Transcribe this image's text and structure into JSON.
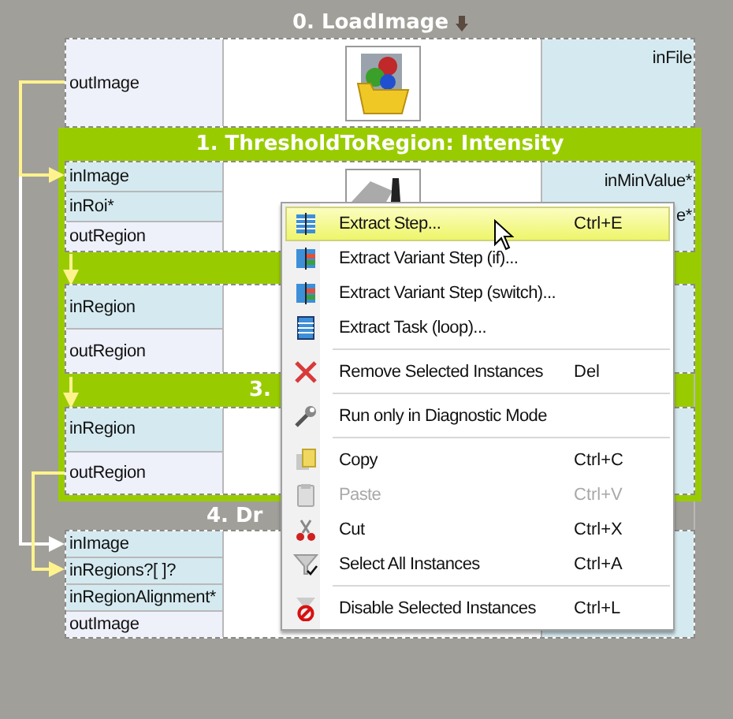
{
  "canvas": {
    "items": [
      {
        "kind": "node",
        "title": "0. LoadImage",
        "left_ports": [
          {
            "label": "outImage",
            "kind": "output"
          }
        ],
        "right_ports": [
          {
            "label": "inFile"
          }
        ]
      },
      {
        "kind": "group",
        "nodes": [
          {
            "title": "1. ThresholdToRegion: Intensity",
            "left_ports": [
              {
                "label": "inImage",
                "kind": "input"
              },
              {
                "label": "inRoi*",
                "kind": "input"
              },
              {
                "label": "outRegion",
                "kind": "output"
              }
            ],
            "right_ports": [
              {
                "label": "inMinValue*"
              },
              {
                "label": "e*"
              }
            ]
          },
          {
            "left_ports": [
              {
                "label": "inRegion",
                "kind": "input"
              },
              {
                "label": "outRegion",
                "kind": "output"
              }
            ]
          },
          {
            "title": "3.",
            "left_ports": [
              {
                "label": "inRegion",
                "kind": "input"
              },
              {
                "label": "outRegion",
                "kind": "output"
              }
            ]
          }
        ]
      },
      {
        "kind": "node",
        "title": "4. Dr",
        "left_ports": [
          {
            "label": "inImage",
            "kind": "input"
          },
          {
            "label": "inRegions?[ ]?",
            "kind": "input"
          },
          {
            "label": "inRegionAlignment*",
            "kind": "input"
          },
          {
            "label": "outImage",
            "kind": "output"
          }
        ]
      }
    ]
  },
  "context_menu": {
    "items": [
      {
        "kind": "item",
        "label": "Extract Step...",
        "shortcut": "Ctrl+E",
        "selected": true,
        "disabled": false
      },
      {
        "kind": "item",
        "label": "Extract Variant Step (if)...",
        "selected": false,
        "disabled": false
      },
      {
        "kind": "item",
        "label": "Extract Variant Step (switch)...",
        "selected": false,
        "disabled": false
      },
      {
        "kind": "item",
        "label": "Extract Task (loop)...",
        "selected": false,
        "disabled": false
      },
      {
        "kind": "separator"
      },
      {
        "kind": "item",
        "label": "Remove Selected Instances",
        "shortcut": "Del",
        "selected": false,
        "disabled": false
      },
      {
        "kind": "separator"
      },
      {
        "kind": "item",
        "label": "Run only in Diagnostic Mode",
        "selected": false,
        "disabled": false
      },
      {
        "kind": "separator"
      },
      {
        "kind": "item",
        "label": "Copy",
        "shortcut": "Ctrl+C",
        "selected": false,
        "disabled": false
      },
      {
        "kind": "item",
        "label": "Paste",
        "shortcut": "Ctrl+V",
        "selected": false,
        "disabled": true
      },
      {
        "kind": "item",
        "label": "Cut",
        "shortcut": "Ctrl+X",
        "selected": false,
        "disabled": false
      },
      {
        "kind": "item",
        "label": "Select All Instances",
        "shortcut": "Ctrl+A",
        "selected": false,
        "disabled": false
      },
      {
        "kind": "separator"
      },
      {
        "kind": "item",
        "label": "Disable Selected Instances",
        "shortcut": "Ctrl+L",
        "selected": false,
        "disabled": false
      }
    ]
  }
}
